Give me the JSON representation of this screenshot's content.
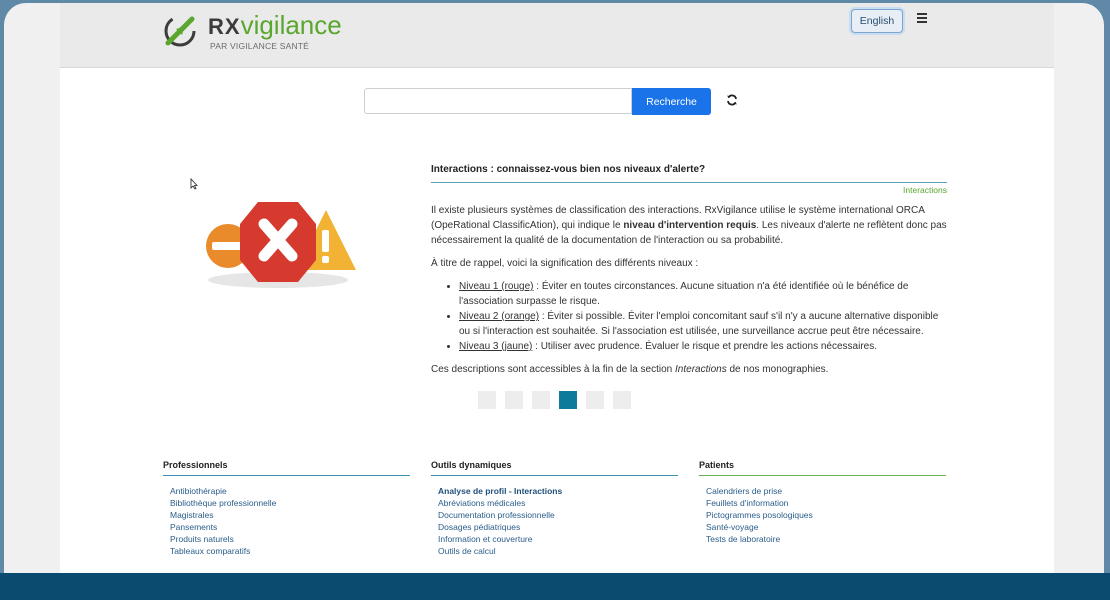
{
  "header": {
    "brand_rx": "RX",
    "brand_vig": "vigilance",
    "brand_sub": "PAR VIGILANCE SANTÉ",
    "lang_label": "English"
  },
  "search": {
    "value": "",
    "button_label": "Recherche"
  },
  "article": {
    "title": "Interactions : connaissez-vous bien nos niveaux d'alerte?",
    "tag": "Interactions",
    "p1_a": "Il existe plusieurs systèmes de classification des interactions. RxVigilance utilise le système international ORCA (OpeRational ClassificAtion), qui indique le ",
    "p1_b": "niveau d'intervention requis",
    "p1_c": ". Les niveaux d'alerte ne reflètent donc pas nécessairement la qualité de la documentation de l'interaction ou sa probabilité.",
    "p2": "À titre de rappel, voici la signification des différents niveaux :",
    "levels": [
      {
        "label": "Niveau 1 (rouge)",
        "text": " : Éviter en toutes circonstances. Aucune situation n'a été identifiée où le bénéfice de l'association surpasse le risque."
      },
      {
        "label": "Niveau 2 (orange)",
        "text": " : Éviter si possible. Éviter l'emploi concomitant sauf s'il n'y a aucune alternative disponible ou si l'interaction est souhaitée. Si l'association est utilisée, une surveillance accrue peut être nécessaire."
      },
      {
        "label": "Niveau 3 (jaune)",
        "text": " : Utiliser avec prudence. Évaluer le risque et prendre les actions nécessaires."
      }
    ],
    "p3_a": "Ces descriptions sont accessibles à la fin de la section ",
    "p3_b": "Interactions",
    "p3_c": " de nos monographies."
  },
  "carousel": {
    "count": 6,
    "active_index": 3
  },
  "footer": {
    "professionnels": {
      "title": "Professionnels",
      "links": [
        "Antibiothérapie",
        "Bibliothèque professionnelle",
        "Magistrales",
        "Pansements",
        "Produits naturels",
        "Tableaux comparatifs"
      ]
    },
    "outils": {
      "title": "Outils dynamiques",
      "links": [
        "Analyse de profil - Interactions",
        "Abréviations médicales",
        "Documentation professionnelle",
        "Dosages pédiatriques",
        "Information et couverture",
        "Outils de calcul"
      ]
    },
    "patients": {
      "title": "Patients",
      "links": [
        "Calendriers de prise",
        "Feuillets d'information",
        "Pictogrammes posologiques",
        "Santé-voyage",
        "Tests de laboratoire"
      ]
    }
  },
  "colors": {
    "accent_blue": "#1a73e8",
    "brand_green": "#5aa62e",
    "active_dot": "#0e7a9b",
    "bottom_band": "#0b4b6f"
  },
  "icons": [
    "logo-mark-icon",
    "menu-icon",
    "refresh-icon",
    "cursor-icon",
    "error-x-icon",
    "warning-triangle-icon",
    "minus-circle-icon"
  ]
}
